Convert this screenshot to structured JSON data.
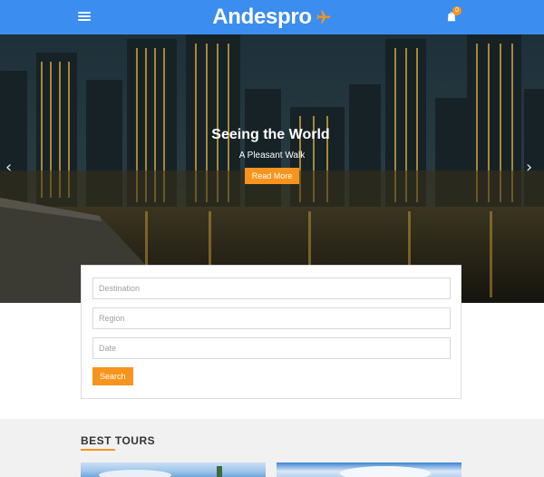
{
  "header": {
    "logo_text": "Andespro",
    "cart_count": "0",
    "brand_color": "#3b8def",
    "accent_color": "#f7941d",
    "icons": [
      "menu-icon",
      "plane-icon",
      "cart-icon"
    ]
  },
  "hero": {
    "title": "Seeing the World",
    "subtitle": "A Pleasant Walk",
    "button_label": "Read More",
    "prev_arrow": "‹",
    "next_arrow": "›"
  },
  "search": {
    "destination_placeholder": "Destination",
    "region_placeholder": "Region",
    "date_placeholder": "Date",
    "button_label": "Search"
  },
  "section": {
    "title": "BEST TOURS"
  }
}
